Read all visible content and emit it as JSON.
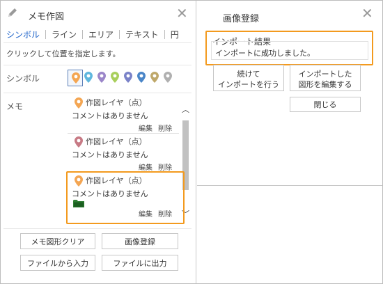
{
  "memo_panel": {
    "title": "メモ作図",
    "tabs": [
      "シンボル",
      "ライン",
      "エリア",
      "テキスト",
      "円"
    ],
    "hint": "クリックして位置を指定します。",
    "symbol_label": "シンボル",
    "memo_label": "メモ",
    "symbol_colors": [
      "#f4a653",
      "#5fb7de",
      "#9b86c9",
      "#a9cf5c",
      "#7a82c8",
      "#4a86c8",
      "#bfa86a",
      "#b0b0b0"
    ],
    "memo_items": [
      {
        "title": "作図レイヤ（点）",
        "comment": "コメントはありません",
        "edit": "編集",
        "delete": "削除",
        "pin_color": "#f4a653",
        "has_folder": false
      },
      {
        "title": "作図レイヤ（点）",
        "comment": "コメントはありません",
        "edit": "編集",
        "delete": "削除",
        "pin_color": "#c77a85",
        "has_folder": false
      },
      {
        "title": "作図レイヤ（点）",
        "comment": "コメントはありません",
        "edit": "編集",
        "delete": "削除",
        "pin_color": "#f4a653",
        "has_folder": true
      }
    ],
    "buttons": {
      "clear": "メモ図形クリア",
      "image_register": "画像登録",
      "import_file": "ファイルから入力",
      "export_file": "ファイルに出力"
    }
  },
  "image_panel": {
    "title": "画像登録",
    "result_title": "インポート結果",
    "result_message": "インポートに成功しました。",
    "buttons": {
      "continue_line1": "続けて",
      "continue_line2": "インポートを行う",
      "edit_line1": "インポートした",
      "edit_line2": "図形を編集する",
      "close": "閉じる"
    }
  },
  "colors": {
    "accent": "#1e63c9",
    "highlight": "#f39a1e",
    "close_icon": "#999999",
    "folder": "#2e7d32"
  }
}
